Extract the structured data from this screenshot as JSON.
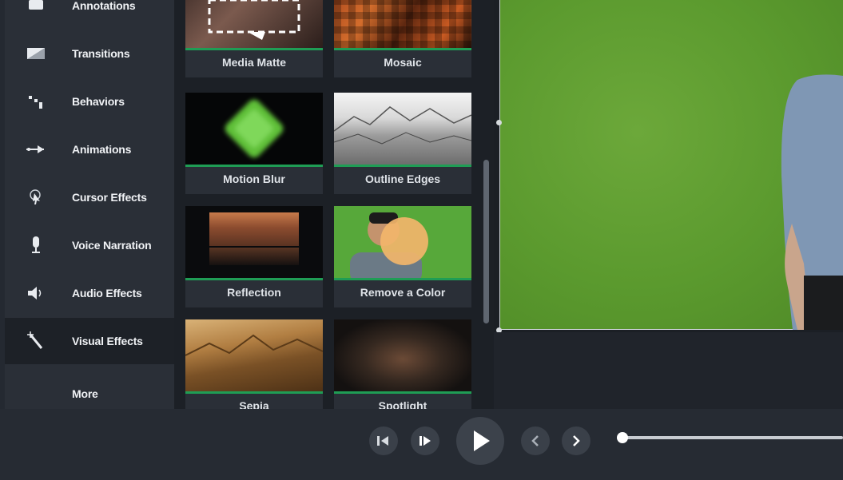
{
  "sidebar": {
    "items": [
      {
        "label": "Annotations",
        "icon": "annotations-icon"
      },
      {
        "label": "Transitions",
        "icon": "transitions-icon"
      },
      {
        "label": "Behaviors",
        "icon": "behaviors-icon"
      },
      {
        "label": "Animations",
        "icon": "animations-icon"
      },
      {
        "label": "Cursor Effects",
        "icon": "cursor-effects-icon"
      },
      {
        "label": "Voice Narration",
        "icon": "microphone-icon"
      },
      {
        "label": "Audio Effects",
        "icon": "speaker-icon"
      },
      {
        "label": "Visual Effects",
        "icon": "magic-wand-icon"
      },
      {
        "label": "More",
        "icon": ""
      }
    ],
    "active": "Visual Effects"
  },
  "effects": [
    {
      "label": "Media Matte"
    },
    {
      "label": "Mosaic"
    },
    {
      "label": "Motion Blur"
    },
    {
      "label": "Outline Edges"
    },
    {
      "label": "Reflection"
    },
    {
      "label": "Remove a Color"
    },
    {
      "label": "Sepia"
    },
    {
      "label": "Spotlight"
    }
  ],
  "colors": {
    "accent_green": "#1f9d55",
    "chroma_green": "#5b9a2e"
  },
  "playback": {
    "buttons": [
      "step-back-icon",
      "step-forward-icon",
      "play-icon",
      "previous-icon",
      "next-icon"
    ],
    "progress": 0
  }
}
